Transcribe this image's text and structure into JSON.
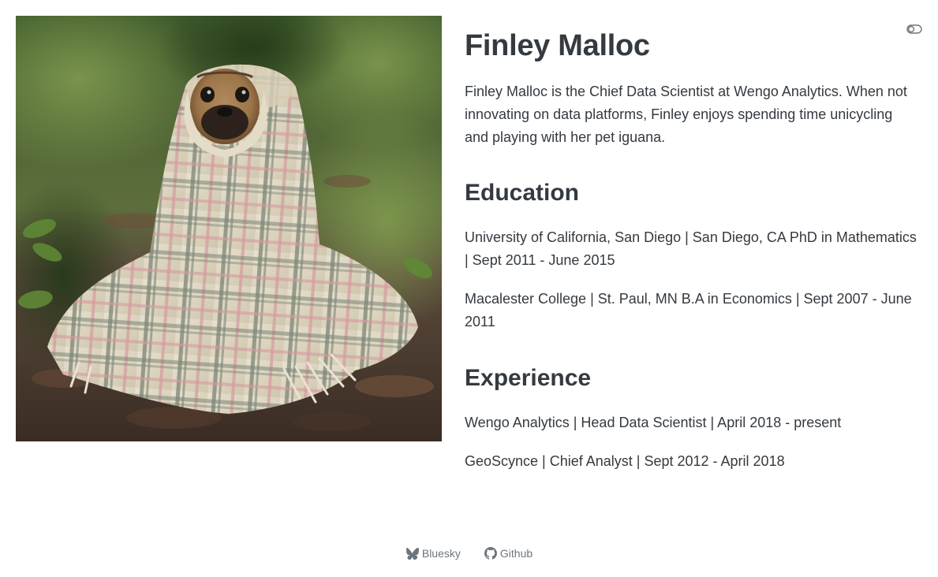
{
  "profile": {
    "name": "Finley Malloc",
    "bio": "Finley Malloc is the Chief Data Scientist at Wengo Analytics. When not innovating on data platforms, Finley enjoys spending time unicycling and playing with her pet iguana."
  },
  "education": {
    "heading": "Education",
    "items": [
      "University of California, San Diego | San Diego, CA PhD in Mathematics | Sept 2011 - June 2015",
      "Macalester College | St. Paul, MN B.A in Economics | Sept 2007 - June 2011"
    ]
  },
  "experience": {
    "heading": "Experience",
    "items": [
      "Wengo Analytics | Head Data Scientist | April 2018 - present",
      "GeoScynce | Chief Analyst | Sept 2012 - April 2018"
    ]
  },
  "footer": {
    "links": [
      {
        "label": "Bluesky",
        "icon": "bluesky-icon"
      },
      {
        "label": "Github",
        "icon": "github-icon"
      }
    ]
  },
  "theme_toggle": {
    "icon": "toggle-icon"
  },
  "profile_photo": {
    "subject": "pug wrapped in plaid blanket in forest"
  },
  "colors": {
    "text": "#343a40",
    "muted": "#6c757d",
    "background": "#ffffff"
  }
}
